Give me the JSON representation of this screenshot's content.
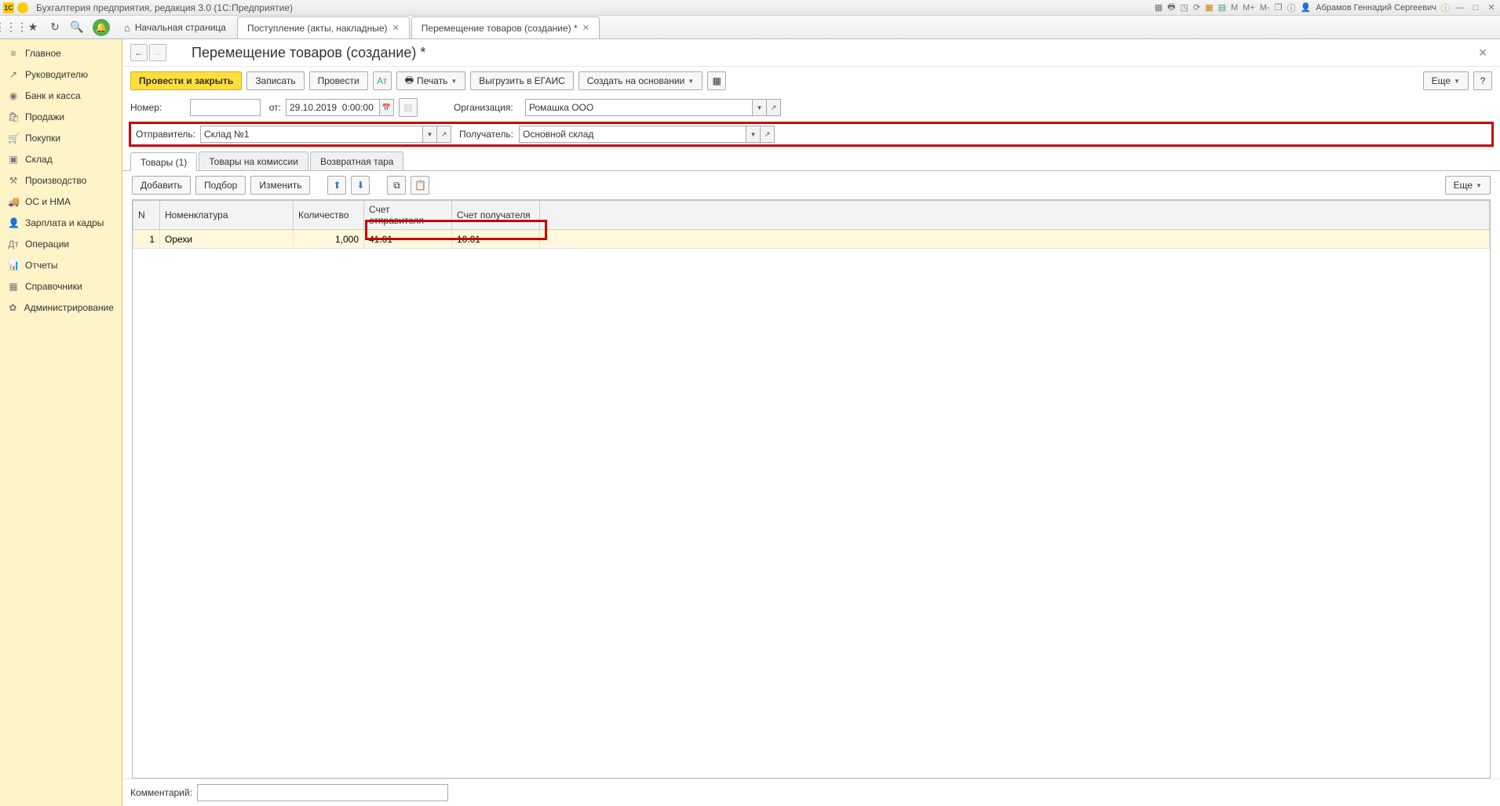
{
  "titlebar": {
    "badge": "1C",
    "title": "Бухгалтерия предприятия, редакция 3.0  (1С:Предприятие)",
    "user": "Абрамов Геннадий Сергеевич",
    "icons": [
      "M",
      "M+",
      "M-"
    ]
  },
  "toptabs": {
    "home": "Начальная страница",
    "tab1": "Поступление (акты, накладные)",
    "tab2": "Перемещение товаров (создание) *"
  },
  "sidebar": {
    "items": [
      {
        "icon": "≡",
        "label": "Главное"
      },
      {
        "icon": "↗",
        "label": "Руководителю"
      },
      {
        "icon": "◉",
        "label": "Банк и касса"
      },
      {
        "icon": "🛍",
        "label": "Продажи"
      },
      {
        "icon": "🛒",
        "label": "Покупки"
      },
      {
        "icon": "▣",
        "label": "Склад"
      },
      {
        "icon": "⚒",
        "label": "Производство"
      },
      {
        "icon": "🚚",
        "label": "ОС и НМА"
      },
      {
        "icon": "👤",
        "label": "Зарплата и кадры"
      },
      {
        "icon": "Дт",
        "label": "Операции"
      },
      {
        "icon": "📊",
        "label": "Отчеты"
      },
      {
        "icon": "▦",
        "label": "Справочники"
      },
      {
        "icon": "✿",
        "label": "Администрирование"
      }
    ]
  },
  "page": {
    "title": "Перемещение товаров (создание) *",
    "buttons": {
      "post_close": "Провести и закрыть",
      "write": "Записать",
      "post": "Провести",
      "print": "Печать",
      "egais": "Выгрузить в ЕГАИС",
      "create_based": "Создать на основании",
      "more": "Еще",
      "help": "?"
    },
    "fields": {
      "number_lbl": "Номер:",
      "number_val": "",
      "date_lbl": "от:",
      "date_val": "29.10.2019  0:00:00",
      "org_lbl": "Организация:",
      "org_val": "Ромашка ООО",
      "sender_lbl": "Отправитель:",
      "sender_val": "Склад №1",
      "receiver_lbl": "Получатель:",
      "receiver_val": "Основной склад"
    },
    "doctabs": {
      "t1": "Товары (1)",
      "t2": "Товары на комиссии",
      "t3": "Возвратная тара"
    },
    "tblbtn": {
      "add": "Добавить",
      "pick": "Подбор",
      "change": "Изменить",
      "more": "Еще"
    },
    "columns": {
      "n": "N",
      "nomen": "Номенклатура",
      "qty": "Количество",
      "acc_send": "Счет отправителя",
      "acc_recv": "Счет получателя"
    },
    "row": {
      "n": "1",
      "nomen": "Орехи",
      "qty": "1,000",
      "acc_send": "41.01",
      "acc_recv": "10.01"
    },
    "comment_lbl": "Комментарий:",
    "comment_val": ""
  }
}
